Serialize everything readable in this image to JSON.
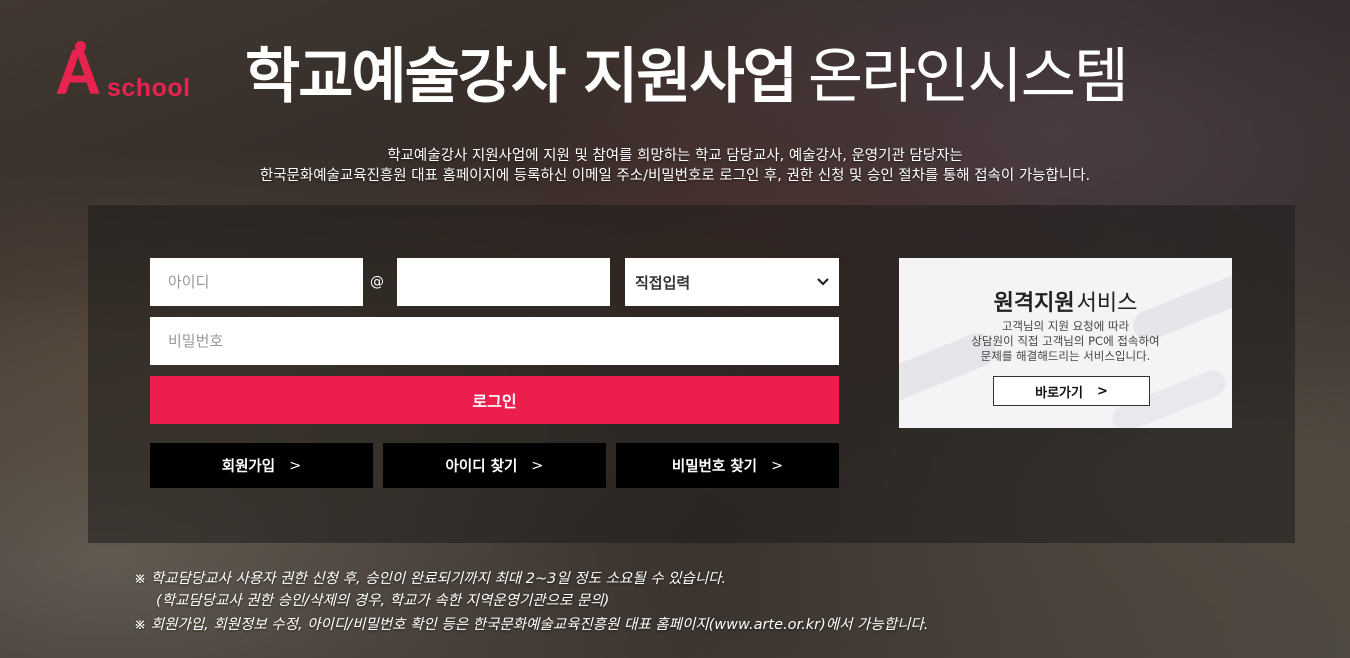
{
  "header": {
    "logo_letter": "A",
    "logo_word": "school",
    "title_bold": "학교예술강사 지원사업",
    "title_light": "온라인시스템"
  },
  "intro": {
    "line1": "학교예술강사 지원사업에 지원 및 참여를 희망하는 학교 담당교사, 예술강사, 운영기관 담당자는",
    "line2": "한국문화예술교육진흥원 대표 홈페이지에 등록하신 이메일 주소/비밀번호로 로그인 후, 권한 신청 및 승인 절차를 통해 접속이 가능합니다."
  },
  "login": {
    "id_placeholder": "아이디",
    "at_symbol": "@",
    "domain_value": "",
    "domain_select_value": "직접입력",
    "password_placeholder": "비밀번호",
    "login_label": "로그인",
    "join_label": "회원가입",
    "find_id_label": "아이디 찾기",
    "find_pw_label": "비밀번호 찾기",
    "arrow": ">"
  },
  "remote": {
    "title_bold": "원격지원",
    "title_normal": "서비스",
    "desc_line1": "고객님의 지원 요청에 따라",
    "desc_line2": "상담원이 직접 고객님의 PC에 접속하여",
    "desc_line3": "문제를 해결해드리는 서비스입니다.",
    "button_label": "바로가기",
    "button_arrow": ">"
  },
  "notes": {
    "note1": "※ 학교담당교사 사용자 권한 신청 후, 승인이 완료되기까지 최대 2~3일 정도 소요될 수 있습니다.",
    "note1_sub": "(학교담당교사 권한 승인/삭제의 경우, 학교가 속한 지역운영기관으로 문의)",
    "note2": "※ 회원가입, 회원정보 수정, 아이디/비밀번호 확인 등은 한국문화예술교육진흥원 대표 홈페이지(www.arte.or.kr)에서 가능합니다."
  },
  "colors": {
    "accent": "#eb1e4e",
    "logo": "#e8234f"
  }
}
